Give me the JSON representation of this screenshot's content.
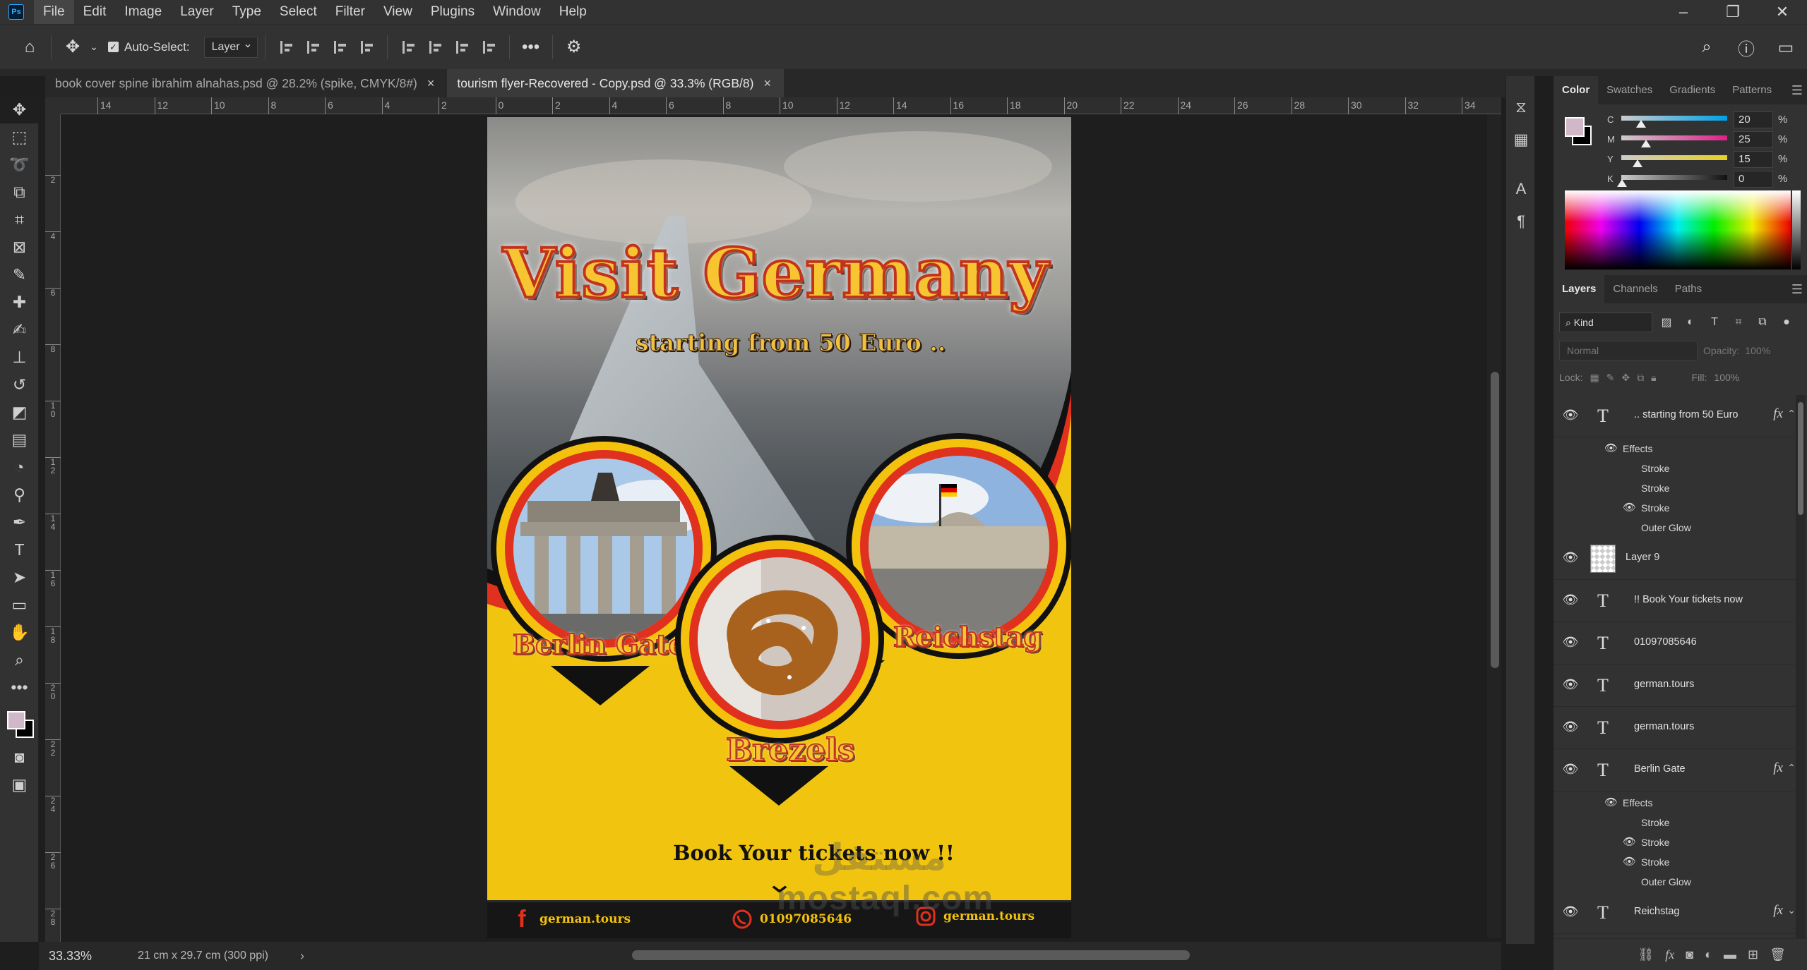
{
  "app": {
    "logo": "Ps",
    "menu": [
      "File",
      "Edit",
      "Image",
      "Layer",
      "Type",
      "Select",
      "Filter",
      "View",
      "Plugins",
      "Window",
      "Help"
    ],
    "window_controls": [
      "minimize-icon",
      "restore-icon",
      "close-icon"
    ]
  },
  "options": {
    "auto_select_label": "Auto-Select:",
    "auto_select_checked": true,
    "target_value": "Layer",
    "more_label": "•••"
  },
  "tabs": [
    {
      "label": "book cover spine ibrahim alnahas.psd @ 28.2% (spike, CMYK/8#)",
      "close": "×",
      "active": false
    },
    {
      "label": "tourism flyer-Recovered - Copy.psd @ 33.3% (RGB/8)",
      "close": "×",
      "active": true
    }
  ],
  "ruler": {
    "h_ticks": [
      "14",
      "12",
      "10",
      "8",
      "6",
      "4",
      "2",
      "0",
      "2",
      "4",
      "6",
      "8",
      "10",
      "12",
      "14",
      "16",
      "18",
      "20",
      "22",
      "24",
      "26",
      "28",
      "30",
      "32",
      "34",
      "3"
    ],
    "v_ticks": [
      "2",
      "4",
      "6",
      "8",
      "1\n0",
      "1\n2",
      "1\n4",
      "1\n6",
      "1\n8",
      "2\n0",
      "2\n2",
      "2\n4",
      "2\n6",
      "2\n8"
    ]
  },
  "status": {
    "zoom": "33.33%",
    "doc_size": "21 cm x 29.7 cm (300 ppi)",
    "arrow": "›"
  },
  "flyer": {
    "title": "Visit Germany !",
    "subtitle": "starting from 50 Euro ..",
    "places": [
      "Berlin Gate",
      "Brezels",
      "Reichstag"
    ],
    "cta": "Book Your tickets now  !!",
    "cta_chevron": "⌄",
    "footer": {
      "facebook_icon": "f",
      "facebook_text": "german.tours",
      "whatsapp_text": "01097085646",
      "instagram_text": "german.tours"
    },
    "watermark": "mostaql.com",
    "watermark_ar": "مستقل",
    "colors": {
      "yellow": "#f1c40f",
      "red": "#e0301e",
      "black": "#111111"
    }
  },
  "color_panel": {
    "tabs": [
      "Color",
      "Swatches",
      "Gradients",
      "Patterns"
    ],
    "foreground": "#d0b8c8",
    "background": "#000000",
    "cmyk": [
      {
        "label": "C",
        "value": "20",
        "pct": "%"
      },
      {
        "label": "M",
        "value": "25",
        "pct": "%"
      },
      {
        "label": "Y",
        "value": "15",
        "pct": "%"
      },
      {
        "label": "K",
        "value": "0",
        "pct": "%"
      }
    ]
  },
  "layers_panel": {
    "tabs": [
      "Layers",
      "Channels",
      "Paths"
    ],
    "kind_label": "Kind",
    "blend_mode": "Normal",
    "opacity_label": "Opacity:",
    "opacity_value": "100%",
    "lock_label": "Lock:",
    "fill_label": "Fill:",
    "fill_value": "100%",
    "effects_label": "Effects",
    "layers": [
      {
        "name": ".. starting from 50 Euro",
        "type": "text",
        "fx": "fx",
        "effects": [
          "Stroke",
          "Stroke",
          "Stroke",
          "Outer Glow"
        ]
      },
      {
        "name": "Layer 9",
        "type": "image"
      },
      {
        "name": "!!  Book Your tickets now",
        "type": "text"
      },
      {
        "name": "01097085646",
        "type": "text"
      },
      {
        "name": "german.tours",
        "type": "text"
      },
      {
        "name": "german.tours",
        "type": "text"
      },
      {
        "name": "Berlin Gate",
        "type": "text",
        "fx": "fx",
        "effects": [
          "Stroke",
          "Stroke",
          "Stroke",
          "Outer Glow"
        ]
      },
      {
        "name": "Reichstag",
        "type": "text",
        "fx": "fx"
      }
    ]
  }
}
